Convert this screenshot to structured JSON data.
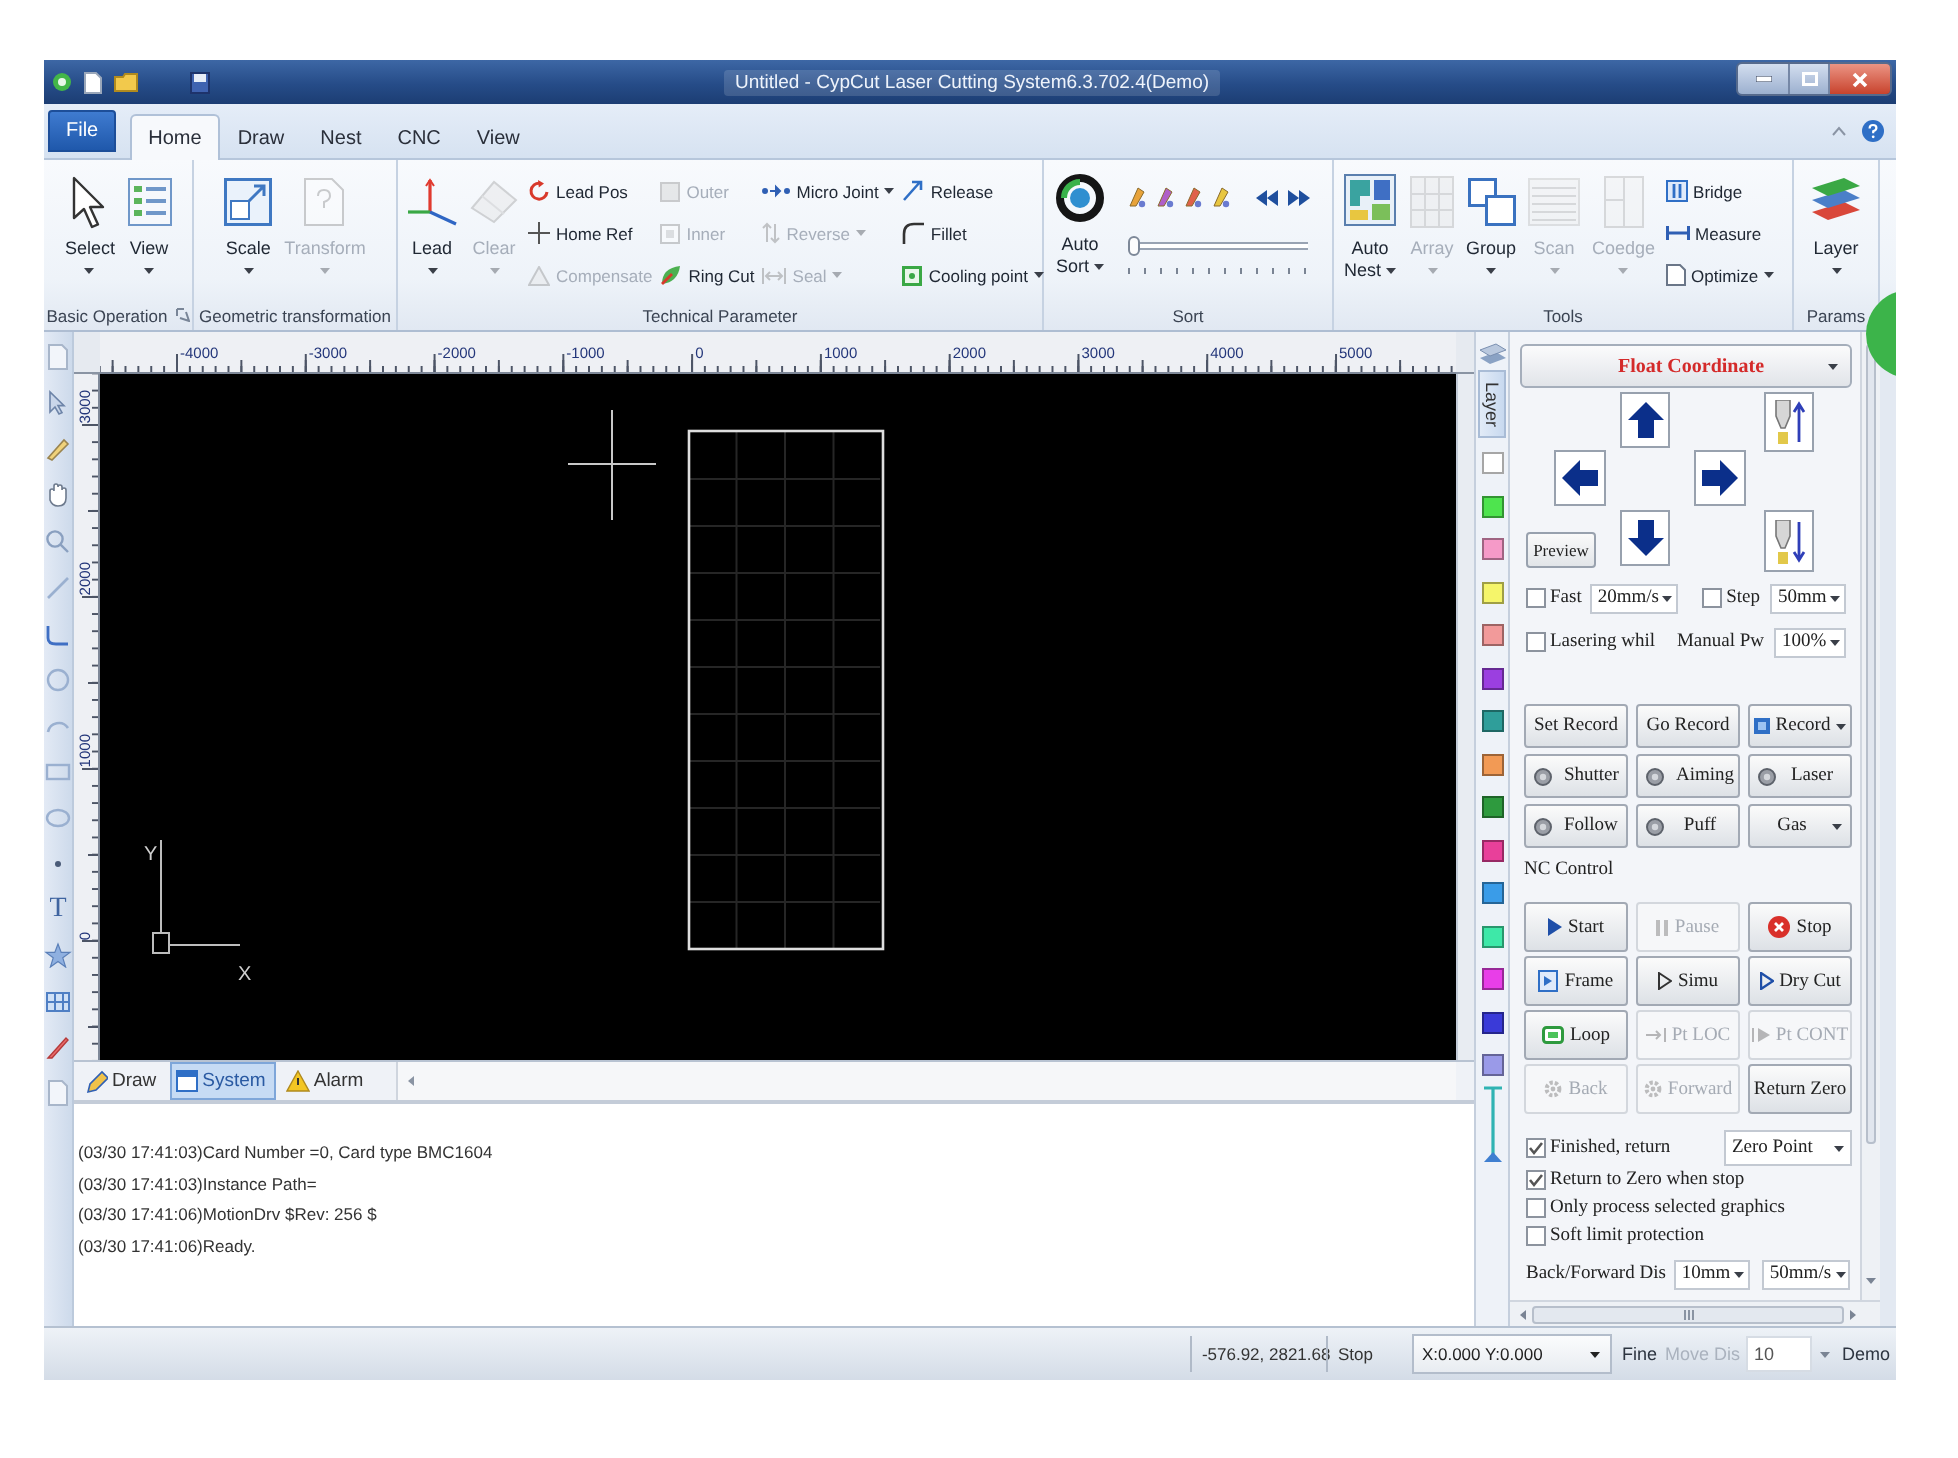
{
  "title_bar": {
    "title": "Untitled - CypCut Laser Cutting System6.3.702.4(Demo)"
  },
  "ribbon_tabs": [
    {
      "label": "File",
      "kind": "file",
      "selected": false
    },
    {
      "label": "Home",
      "kind": "tab",
      "selected": true
    },
    {
      "label": "Draw",
      "kind": "tab",
      "selected": false
    },
    {
      "label": "Nest",
      "kind": "tab",
      "selected": false
    },
    {
      "label": "CNC",
      "kind": "tab",
      "selected": false
    },
    {
      "label": "View",
      "kind": "tab",
      "selected": false
    }
  ],
  "ribbon_groups": [
    {
      "label": "Basic Operation",
      "launcher": true,
      "items": [
        {
          "kind": "large",
          "label": "Select",
          "dropdown": true,
          "disabled": false
        },
        {
          "kind": "large",
          "label": "View",
          "dropdown": true,
          "disabled": false
        }
      ]
    },
    {
      "label": "Geometric transformation",
      "items": [
        {
          "kind": "large",
          "label": "Scale",
          "dropdown": true,
          "disabled": false
        },
        {
          "kind": "large",
          "label": "Transform",
          "dropdown": true,
          "disabled": true
        }
      ]
    },
    {
      "label": "Technical Parameter",
      "items": [
        {
          "kind": "large",
          "label": "Lead",
          "dropdown": true,
          "disabled": false
        },
        {
          "kind": "large",
          "label": "Clear",
          "dropdown": true,
          "disabled": true
        },
        {
          "kind": "column",
          "buttons": [
            {
              "label": "Lead Pos",
              "dropdown": false,
              "disabled": false
            },
            {
              "label": "Home Ref",
              "dropdown": false,
              "disabled": false
            },
            {
              "label": "Compensate",
              "dropdown": false,
              "disabled": true
            }
          ]
        },
        {
          "kind": "column",
          "buttons": [
            {
              "label": "Outer",
              "dropdown": false,
              "disabled": true
            },
            {
              "label": "Inner",
              "dropdown": false,
              "disabled": true
            },
            {
              "label": "Ring Cut",
              "dropdown": false,
              "disabled": false
            }
          ]
        },
        {
          "kind": "column",
          "buttons": [
            {
              "label": "Micro Joint",
              "dropdown": true,
              "disabled": false
            },
            {
              "label": "Reverse",
              "dropdown": true,
              "disabled": true
            },
            {
              "label": "Seal",
              "dropdown": true,
              "disabled": true
            }
          ]
        },
        {
          "kind": "column",
          "buttons": [
            {
              "label": "Release",
              "dropdown": false,
              "disabled": false
            },
            {
              "label": "Fillet",
              "dropdown": false,
              "disabled": false
            },
            {
              "label": "Cooling point",
              "dropdown": true,
              "disabled": false
            }
          ]
        }
      ]
    },
    {
      "label": "Sort",
      "items": [
        {
          "kind": "stacked",
          "label": "Auto Sort",
          "dropdown": true,
          "disabled": false
        },
        {
          "kind": "sequence",
          "level": 0
        }
      ]
    },
    {
      "label": "Tools",
      "items": [
        {
          "kind": "stacked",
          "label": "Auto Nest",
          "dropdown": true,
          "disabled": false
        },
        {
          "kind": "large",
          "label": "Array",
          "dropdown": true,
          "disabled": true
        },
        {
          "kind": "large",
          "label": "Group",
          "dropdown": true,
          "disabled": false
        },
        {
          "kind": "large",
          "label": "Scan",
          "dropdown": true,
          "disabled": true
        },
        {
          "kind": "large",
          "label": "Coedge",
          "dropdown": true,
          "disabled": true
        },
        {
          "kind": "column",
          "buttons": [
            {
              "label": "Bridge",
              "dropdown": false,
              "disabled": false
            },
            {
              "label": "Measure",
              "dropdown": false,
              "disabled": false
            },
            {
              "label": "Optimize",
              "dropdown": true,
              "disabled": false
            }
          ]
        }
      ]
    },
    {
      "label": "Params",
      "items": [
        {
          "kind": "large",
          "label": "Layer",
          "dropdown": true,
          "disabled": false
        }
      ]
    }
  ],
  "tool_strip": {
    "text_tool": "T"
  },
  "rulers": {
    "horizontal": [
      "-4000",
      "-3000",
      "-2000",
      "-1000",
      "0",
      "1000",
      "2000",
      "3000",
      "4000",
      "5000"
    ],
    "vertical": [
      "3000",
      "2000",
      "1000",
      "0"
    ]
  },
  "canvas": {
    "axis_x": "X",
    "axis_y": "Y"
  },
  "bottom_tabs": [
    {
      "label": "Draw",
      "selected": false
    },
    {
      "label": "System",
      "selected": true
    },
    {
      "label": "Alarm",
      "selected": false
    }
  ],
  "log": [
    "(03/30 17:41:03)Card Number =0, Card type BMC1604",
    "(03/30 17:41:03)Instance Path=",
    "(03/30 17:41:06)MotionDrv $Rev: 256 $",
    "(03/30 17:41:06)Ready."
  ],
  "layer_panel": {
    "title": "Layer",
    "swatches": [
      {
        "color": "#ffffff"
      },
      {
        "color": "#4ee44e"
      },
      {
        "color": "#f59ac8"
      },
      {
        "color": "#f5f56a"
      },
      {
        "color": "#f29a9a"
      },
      {
        "color": "#9b3fe0"
      },
      {
        "color": "#2f9e9a"
      },
      {
        "color": "#f29a55"
      },
      {
        "color": "#2e9a3e"
      },
      {
        "color": "#e8409a"
      },
      {
        "color": "#3a9ce8"
      },
      {
        "color": "#3ee8a8"
      },
      {
        "color": "#e83ee8"
      },
      {
        "color": "#3a3ad8"
      },
      {
        "color": "#9a9ae8"
      }
    ]
  },
  "control_panel": {
    "coordinate_mode": "Float Coordinate",
    "preview": "Preview",
    "jog_options": [
      {
        "label": "Fast",
        "checked": false,
        "value": "20mm/s"
      },
      {
        "label": "Step",
        "checked": false,
        "value": "50mm"
      }
    ],
    "lasering": {
      "label": "Lasering whil",
      "checked": false,
      "power_label": "Manual Pw",
      "power_value": "100%"
    },
    "laser_buttons": [
      {
        "label": "Set Record",
        "kind": "plain"
      },
      {
        "label": "Go Record",
        "kind": "plain"
      },
      {
        "label": "Record",
        "kind": "menu"
      },
      {
        "label": "Shutter",
        "kind": "toggle",
        "on": false
      },
      {
        "label": "Aiming",
        "kind": "toggle",
        "on": false
      },
      {
        "label": "Laser",
        "kind": "toggle",
        "on": false
      },
      {
        "label": "Follow",
        "kind": "toggle",
        "on": false
      },
      {
        "label": "Puff",
        "kind": "toggle",
        "on": false
      },
      {
        "label": "Gas",
        "kind": "dropdown"
      }
    ],
    "nc_title": "NC Control",
    "nc_buttons": [
      {
        "label": "Start",
        "disabled": false
      },
      {
        "label": "Pause",
        "disabled": true
      },
      {
        "label": "Stop",
        "disabled": false
      },
      {
        "label": "Frame",
        "disabled": false
      },
      {
        "label": "Simu",
        "disabled": false
      },
      {
        "label": "Dry Cut",
        "disabled": false
      },
      {
        "label": "Loop",
        "disabled": false
      },
      {
        "label": "Pt LOC",
        "disabled": true
      },
      {
        "label": "Pt CONT",
        "disabled": true
      },
      {
        "label": "Back",
        "disabled": true
      },
      {
        "label": "Forward",
        "disabled": true
      },
      {
        "label": "Return Zero",
        "disabled": false
      }
    ],
    "options": [
      {
        "label": "Finished, return",
        "checked": true,
        "select": "Zero Point"
      },
      {
        "label": "Return to Zero when stop",
        "checked": true
      },
      {
        "label": "Only process selected graphics",
        "checked": false
      },
      {
        "label": "Soft limit protection",
        "checked": false
      }
    ],
    "back_forward": {
      "label": "Back/Forward Dis",
      "distance": "10mm",
      "speed": "50mm/s"
    }
  },
  "status_bar": {
    "cursor_position": "-576.92, 2821.68",
    "machine_state": "Stop",
    "coordinate_select": "X:0.000 Y:0.000",
    "precision": "Fine",
    "move_distance": {
      "label": "Move Dis",
      "disabled": true,
      "value": "10"
    },
    "mode": "Demo"
  }
}
